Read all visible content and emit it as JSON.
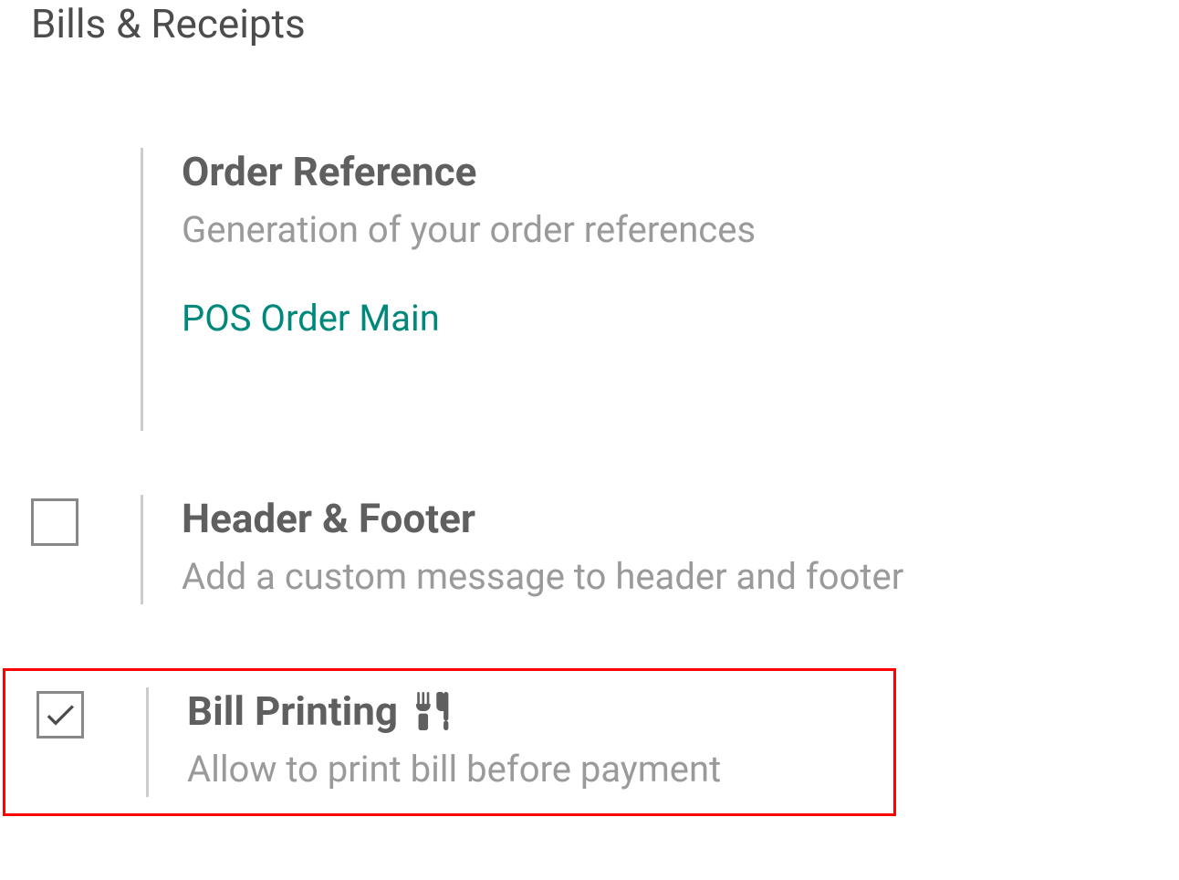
{
  "section": {
    "title": "Bills & Receipts"
  },
  "settings": [
    {
      "title": "Order Reference",
      "description": "Generation of your order references",
      "link": "POS Order Main",
      "checked": null
    },
    {
      "title": "Header & Footer",
      "description": "Add a custom message to header and footer",
      "checked": false
    },
    {
      "title": "Bill Printing",
      "description": "Allow to print bill before payment",
      "checked": true,
      "icon": "utensils"
    }
  ]
}
